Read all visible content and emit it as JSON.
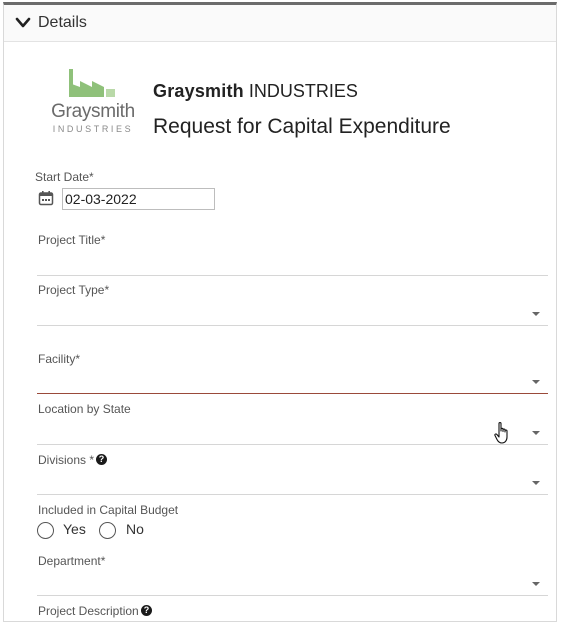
{
  "panel": {
    "title": "Details"
  },
  "header": {
    "logo_word": "Graysmith",
    "logo_sub": "INDUSTRIES",
    "company_bold": "Graysmith",
    "company_rest": "INDUSTRIES",
    "form_title": "Request for Capital Expenditure"
  },
  "fields": {
    "start_date": {
      "label": "Start Date*",
      "value": "02-03-2022"
    },
    "project_title": {
      "label": "Project Title*"
    },
    "project_type": {
      "label": "Project Type*"
    },
    "facility": {
      "label": "Facility*"
    },
    "location": {
      "label": "Location by State"
    },
    "divisions": {
      "label": "Divisions *"
    },
    "capital_budget": {
      "label": "Included in Capital Budget",
      "yes": "Yes",
      "no": "No"
    },
    "department": {
      "label": "Department*"
    },
    "project_description": {
      "label": "Project Description"
    }
  },
  "colors": {
    "logo_green": "#8fc17a",
    "active_underline": "#9a4a3a",
    "header_border": "#6b6b6b"
  },
  "icons": [
    "chevron-down-icon",
    "calendar-icon",
    "dropdown-caret-icon",
    "help-icon",
    "pointer-hand-icon"
  ]
}
